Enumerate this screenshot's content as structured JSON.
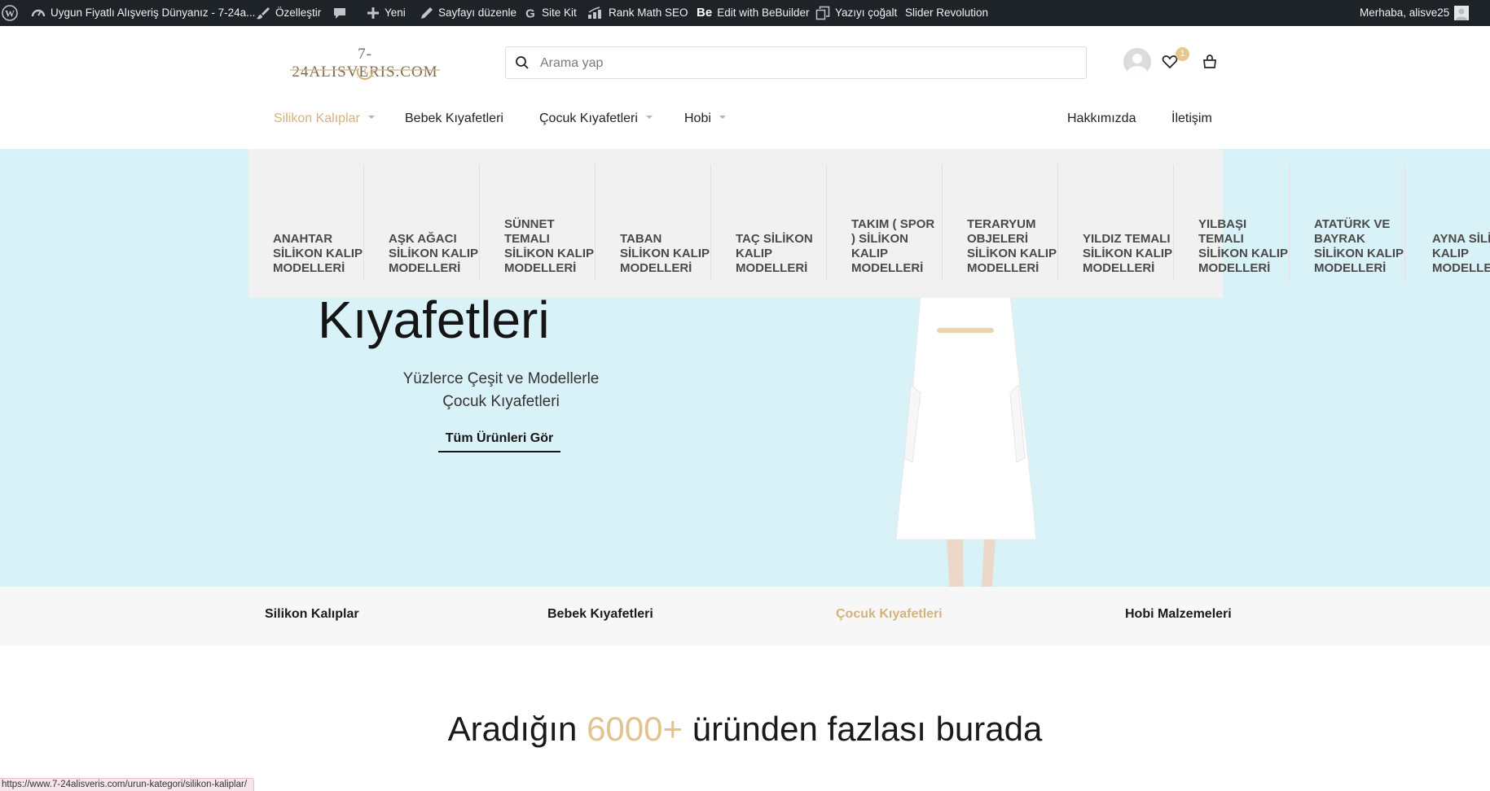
{
  "admin_bar": {
    "wp_logo_icon": "wordpress-icon",
    "site_name": "Uygun Fiyatlı Alışveriş Dünyanız - 7-24a...",
    "customize": "Özelleştir",
    "comments_icon": "comment-icon",
    "new": "Yeni",
    "edit_page": "Sayfayı düzenle",
    "site_kit": "Site Kit",
    "rank_math": "Rank Math SEO",
    "bebuilder_prefix": "Be",
    "bebuilder": "Edit with BeBuilder",
    "duplicate": "Yazıyı çoğalt",
    "slider_revolution": "Slider Revolution",
    "greeting": "Merhaba, alisve25"
  },
  "header": {
    "logo_text": "7-24ALISVERIS.COM",
    "search_placeholder": "Arama yap",
    "wishlist_count": "1"
  },
  "nav": {
    "items": [
      {
        "label": "Silikon Kalıplar",
        "has_dropdown": true,
        "active": true
      },
      {
        "label": "Bebek Kıyafetleri",
        "has_dropdown": false
      },
      {
        "label": "Çocuk Kıyafetleri",
        "has_dropdown": true
      },
      {
        "label": "Hobi",
        "has_dropdown": true
      }
    ],
    "right": [
      "Hakkımızda",
      "İletişim"
    ]
  },
  "mega_menu": {
    "items": [
      "ANAHTAR SİLİKON KALIP MODELLERİ",
      "AŞK AĞACI SİLİKON KALIP MODELLERİ",
      "SÜNNET TEMALI SİLİKON KALIP MODELLERİ",
      "TABAN SİLİKON KALIP MODELLERİ",
      "TAÇ SİLİKON KALIP MODELLERİ",
      "TAKIM ( SPOR ) SİLİKON KALIP MODELLERİ",
      "TERARYUM OBJELERİ SİLİKON KALIP MODELLERİ",
      "YILDIZ TEMALI SİLİKON KALIP MODELLERİ",
      "YILBAŞI TEMALI SİLİKON KALIP MODELLERİ",
      "ATATÜRK VE BAYRAK SİLİKON KALIP MODELLERİ",
      "AYNA SİLİKON KALIP MODELLERİ"
    ]
  },
  "hero": {
    "title": "Kıyafetleri",
    "subtitle_line1": "Yüzlerce Çeşit ve Modellerle",
    "subtitle_line2": "Çocuk Kıyafetleri",
    "cta": "Tüm Ürünleri Gör"
  },
  "category_bar": {
    "items": [
      {
        "label": "Silikon Kalıplar",
        "active": false
      },
      {
        "label": "Bebek Kıyafetleri",
        "active": false
      },
      {
        "label": "Çocuk Kıyafetleri",
        "active": true
      },
      {
        "label": "Hobi Malzemeleri",
        "active": false
      }
    ]
  },
  "section": {
    "heading_before": "Aradığın ",
    "heading_accent": "6000+",
    "heading_after": " üründen fazlası burada"
  },
  "status_bar": {
    "url": "https://www.7-24alisveris.com/urun-kategori/silikon-kaliplar/"
  },
  "colors": {
    "admin_bar_bg": "#1d2327",
    "accent_gold": "#d4b47c",
    "hero_bg": "#d9f2f7",
    "mega_bg": "#f1f1f1"
  }
}
